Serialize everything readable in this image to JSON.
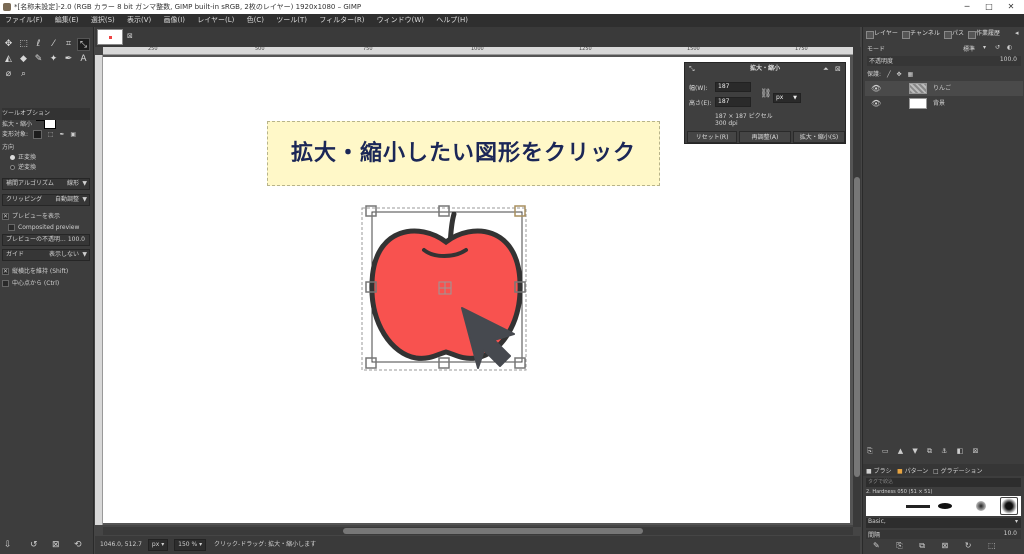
{
  "window": {
    "title": "*[名称未設定]-2.0 (RGB カラー 8 bit ガンマ整数, GIMP built-in sRGB, 2枚のレイヤー) 1920x1080 – GIMP",
    "controls": [
      "─",
      "□",
      "✕"
    ]
  },
  "menu": [
    "ファイル(F)",
    "編集(E)",
    "選択(S)",
    "表示(V)",
    "画像(I)",
    "レイヤー(L)",
    "色(C)",
    "ツール(T)",
    "フィルター(R)",
    "ウィンドウ(W)",
    "ヘルプ(H)"
  ],
  "tool_options": {
    "panel_tab": "ツールオプション",
    "tool_name": "拡大・縮小",
    "transform_label": "変形対象:",
    "direction_label": "方向",
    "direction_forward": "正変換",
    "direction_backward": "逆変換",
    "interpolation_label": "補間アルゴリズム",
    "interpolation_value": "線形",
    "clipping_label": "クリッピング",
    "clipping_value": "自動調整",
    "show_preview": "プレビューを表示",
    "composited_preview": "Composited preview",
    "preview_opacity": "プレビューの不透明...",
    "preview_opacity_value": "100.0",
    "guides_label": "ガイド",
    "guides_value": "表示しない",
    "keep_aspect": "縦横比を維持 (Shift)",
    "from_center": "中心点から (Ctrl)"
  },
  "ruler_ticks": [
    "250",
    "500",
    "750",
    "1000",
    "1250",
    "1500",
    "1750"
  ],
  "canvas": {
    "banner": "拡大・縮小したい図形をクリック"
  },
  "scale_dialog": {
    "title": "拡大・縮小",
    "width_label": "幅(W):",
    "width_value": "187",
    "height_label": "高さ(E):",
    "height_value": "187",
    "unit": "px",
    "size_info": "187 × 187 ピクセル",
    "dpi_info": "300 dpi",
    "reset_button": "リセット(R)",
    "readjust_button": "再調整(A)",
    "scale_button": "拡大・縮小(S)"
  },
  "status": {
    "coords": "1046.0, 512.7",
    "unit": "px",
    "zoom": "150 %",
    "message": "クリック-ドラッグ: 拡大・縮小します"
  },
  "layers_panel": {
    "tabs": [
      "レイヤー",
      "チャンネル",
      "パス",
      "作業履歴"
    ],
    "mode_label": "モード",
    "mode_value": "標準",
    "opacity_label": "不透明度",
    "opacity_value": "100.0",
    "lock_label": "保護:",
    "layers": [
      {
        "name": "りんご"
      },
      {
        "name": "背景"
      }
    ]
  },
  "brushes_panel": {
    "tabs": [
      "ブラシ",
      "パターン",
      "グラデーション"
    ],
    "filter_placeholder": "タグで絞込",
    "brush_name": "2. Hardness 050 (51 × 51)",
    "preset": "Basic,",
    "spacing_label": "間隔",
    "spacing_value": "10.0"
  },
  "colors": {
    "apple": "#f8524f",
    "outline": "#333333",
    "cursor": "#46494f",
    "banner_bg": "#fff8c8",
    "banner_text": "#1b2757"
  }
}
